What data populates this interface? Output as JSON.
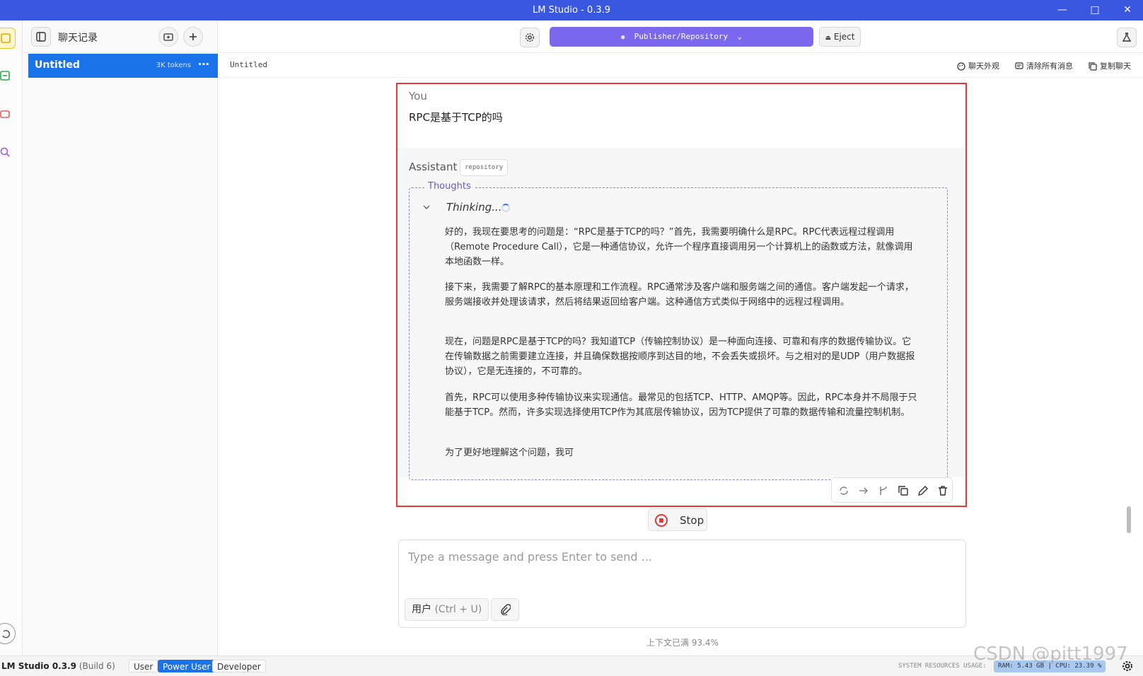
{
  "window": {
    "title": "LM Studio - 0.3.9"
  },
  "sidebar": {
    "header_label": "聊天记录",
    "chats": [
      {
        "name": "Untitled",
        "tokens": "3K tokens"
      }
    ]
  },
  "topbar": {
    "model": "Publisher/Repository",
    "eject_label": "Eject"
  },
  "subbar": {
    "doc_title": "Untitled",
    "actions": {
      "appearance": "聊天外观",
      "clear": "清除所有消息",
      "copy": "复制聊天"
    }
  },
  "conversation": {
    "user_label": "You",
    "user_message": "RPC是基于TCP的吗",
    "assistant_label": "Assistant",
    "assistant_tag": "repository",
    "thoughts_label": "Thoughts",
    "thinking_label": "Thinking...",
    "paragraphs": [
      "好的，我现在要思考的问题是：“RPC是基于TCP的吗？”首先，我需要明确什么是RPC。RPC代表远程过程调用（Remote Procedure Call），它是一种通信协议，允许一个程序直接调用另一个计算机上的函数或方法，就像调用本地函数一样。",
      "接下来，我需要了解RPC的基本原理和工作流程。RPC通常涉及客户端和服务端之间的通信。客户端发起一个请求，服务端接收并处理该请求，然后将结果返回给客户端。这种通信方式类似于网络中的远程过程调用。",
      "现在，问题是RPC是基于TCP的吗？我知道TCP（传输控制协议）是一种面向连接、可靠和有序的数据传输协议。它在传输数据之前需要建立连接，并且确保数据按顺序到达目的地，不会丢失或损坏。与之相对的是UDP（用户数据报协议），它是无连接的，不可靠的。",
      "首先，RPC可以使用多种传输协议来实现通信。最常见的包括TCP、HTTP、AMQP等。因此，RPC本身并不局限于只能基于TCP。然而，许多实现选择使用TCP作为其底层传输协议，因为TCP提供了可靠的数据传输和流量控制机制。",
      "为了更好地理解这个问题，我可"
    ]
  },
  "composer": {
    "stop_label": "Stop",
    "placeholder": "Type a message and press Enter to send ...",
    "role_label": "用户",
    "role_shortcut": "(Ctrl + U)",
    "context_usage": "上下文已满 93.4%"
  },
  "statusbar": {
    "app_name": "LM Studio 0.3.9",
    "build": "(Build 6)",
    "modes": [
      "User",
      "Power User",
      "Developer"
    ],
    "active_mode": "Power User",
    "system_label": "SYSTEM RESOURCES USAGE:",
    "ram": "RAM: 5.43 GB",
    "cpu": "CPU: 23.39 %"
  },
  "watermark": "CSDN @pitt1997",
  "colors": {
    "titlebar": "#3a57e0",
    "accent": "#1a73e8",
    "model_button": "#7b68ee",
    "highlight_border": "#e53935"
  },
  "icons": [
    "sidebar-toggle-icon",
    "new-folder-icon",
    "plus-icon",
    "gear-icon",
    "flask-icon",
    "chevron-down-icon",
    "stop-icon",
    "paperclip-icon",
    "refresh-icon",
    "arrow-right-icon",
    "branch-icon",
    "copy-icon",
    "edit-icon",
    "trash-icon"
  ]
}
